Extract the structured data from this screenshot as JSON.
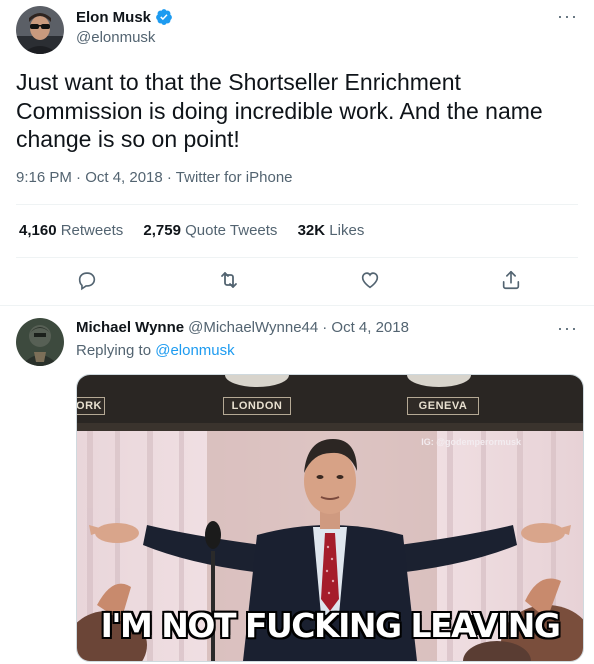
{
  "tweet": {
    "author": {
      "name": "Elon Musk",
      "handle": "@elonmusk",
      "verified": true,
      "verified_color": "#1d9bf0"
    },
    "text": "Just want to that the Shortseller Enrichment Commission is doing incredible work. And the name change is so on point!",
    "timestamp": "9:16 PM · Oct 4, 2018 · Twitter for iPhone",
    "stats": {
      "retweets_count": "4,160",
      "retweets_label": "Retweets",
      "quotes_count": "2,759",
      "quotes_label": "Quote Tweets",
      "likes_count": "32K",
      "likes_label": "Likes"
    },
    "more_glyph": "···",
    "actions": [
      "reply-icon",
      "retweet-icon",
      "like-icon",
      "share-icon"
    ]
  },
  "reply": {
    "author": {
      "name": "Michael Wynne",
      "handle": "@MichaelWynne44"
    },
    "date": "· Oct 4, 2018",
    "replying_prefix": "Replying to",
    "replying_to": "@elonmusk",
    "more_glyph": "···",
    "media": {
      "signs": [
        "ORK",
        "LONDON",
        "GENEVA"
      ],
      "watermark": "IG: @godemperormusk",
      "caption": "I'M NOT FUCKING LEAVING"
    }
  },
  "colors": {
    "text": "#0f1419",
    "secondary": "#536471",
    "link": "#1d9bf0",
    "divider": "#eff3f4"
  }
}
